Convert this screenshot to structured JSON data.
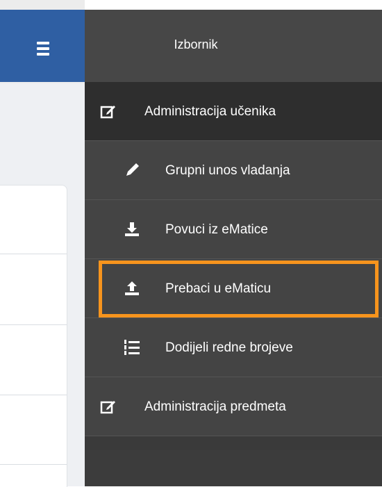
{
  "sidebar": {
    "title": "Izbornik",
    "items": [
      {
        "label": "Administracija učenika",
        "icon": "edit-icon"
      },
      {
        "label": "Grupni unos vladanja",
        "icon": "pencil-icon"
      },
      {
        "label": "Povuci iz eMatice",
        "icon": "download-icon"
      },
      {
        "label": "Prebaci u eMaticu",
        "icon": "upload-icon"
      },
      {
        "label": "Dodijeli redne brojeve",
        "icon": "numbered-list-icon"
      },
      {
        "label": "Administracija predmeta",
        "icon": "edit-icon"
      }
    ]
  },
  "header": {
    "menu_icon": "hamburger-icon"
  },
  "colors": {
    "header_blue": "#2f5fa3",
    "sidebar_bg": "#444444",
    "highlight": "#f7941d"
  }
}
